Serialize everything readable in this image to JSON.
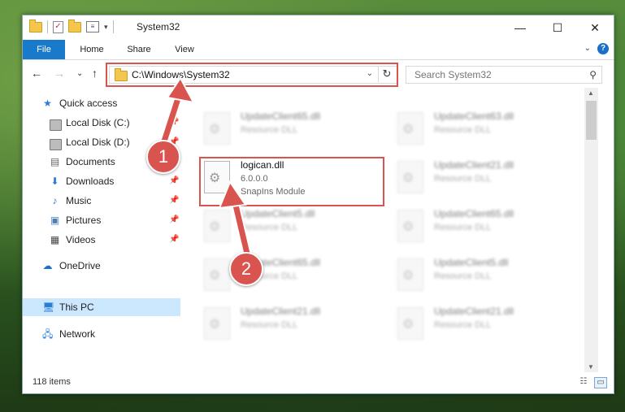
{
  "window": {
    "title": "System32",
    "controls": {
      "minimize": "—",
      "maximize": "☐",
      "close": "✕"
    }
  },
  "ribbon": {
    "tabs": [
      "File",
      "Home",
      "Share",
      "View"
    ],
    "help": "?"
  },
  "address_bar": {
    "path": "C:\\Windows\\System32",
    "search_placeholder": "Search System32"
  },
  "sidebar": {
    "items": [
      {
        "label": "Quick access",
        "icon": "star-icon"
      },
      {
        "label": "Local Disk (C:)",
        "icon": "drive-icon"
      },
      {
        "label": "Local Disk (D:)",
        "icon": "drive-icon"
      },
      {
        "label": "Documents",
        "icon": "documents-icon"
      },
      {
        "label": "Downloads",
        "icon": "download-icon"
      },
      {
        "label": "Music",
        "icon": "music-icon"
      },
      {
        "label": "Pictures",
        "icon": "pictures-icon"
      },
      {
        "label": "Videos",
        "icon": "videos-icon"
      },
      {
        "label": "OneDrive",
        "icon": "cloud-icon"
      },
      {
        "label": "This PC",
        "icon": "computer-icon"
      },
      {
        "label": "Network",
        "icon": "network-icon"
      }
    ]
  },
  "files": {
    "highlighted": {
      "name": "logican.dll",
      "version": "6.0.0.0",
      "description": "SnapIns Module"
    },
    "blurred": [
      {
        "name": "UpdateClient65.dll",
        "type": "Resource DLL"
      },
      {
        "name": "UpdateClient63.dll",
        "type": "Resource DLL"
      },
      {
        "name": "UpdateClient21.dll",
        "type": "Resource DLL"
      },
      {
        "name": "UpdateClient5.dll",
        "type": "Resource DLL"
      },
      {
        "name": "UpdateClient65.dll",
        "type": "Resource DLL"
      },
      {
        "name": "UpdateClient65.dll",
        "type": "Resource DLL"
      },
      {
        "name": "UpdateClient5.dll",
        "type": "Resource DLL"
      },
      {
        "name": "UpdateClient21.dll",
        "type": "Resource DLL"
      },
      {
        "name": "UpdateClient21.dll",
        "type": "Resource DLL"
      }
    ]
  },
  "status": {
    "item_count": "118 items"
  },
  "callouts": [
    "1",
    "2"
  ],
  "colors": {
    "accent": "#1979ca",
    "highlight": "#d9534f",
    "selected": "#cce8ff"
  }
}
